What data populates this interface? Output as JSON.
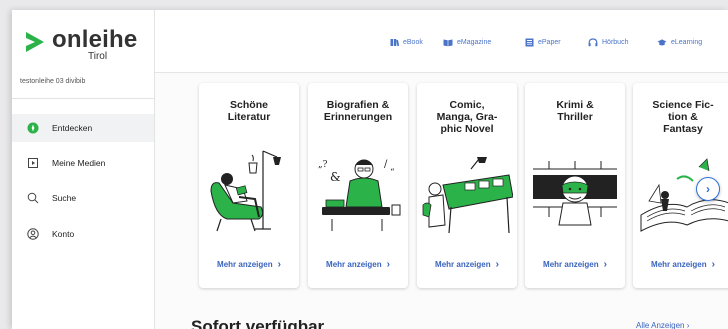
{
  "brand": {
    "name": "onleihe",
    "region": "Tirol"
  },
  "library_name": "testonleihe 03 divibib",
  "nav": [
    {
      "label": "Entdecken",
      "icon": "compass-icon",
      "active": true
    },
    {
      "label": "Meine Medien",
      "icon": "media-icon",
      "active": false
    },
    {
      "label": "Suche",
      "icon": "search-icon",
      "active": false
    },
    {
      "label": "Konto",
      "icon": "account-icon",
      "active": false
    }
  ],
  "media_types": [
    {
      "label": "eBook",
      "icon": "book-icon"
    },
    {
      "label": "eMagazine",
      "icon": "magazine-icon"
    },
    {
      "label": "ePaper",
      "icon": "newspaper-icon"
    },
    {
      "label": "Hörbuch",
      "icon": "headphones-icon"
    },
    {
      "label": "eLearning",
      "icon": "graduation-cap-icon"
    }
  ],
  "categories": [
    {
      "title": "Schöne\nLiteratur",
      "more": "Mehr anzeigen"
    },
    {
      "title": "Biografien &\nErinnerungen",
      "more": "Mehr anzeigen"
    },
    {
      "title": "Comic,\nManga, Gra-\nphic Novel",
      "more": "Mehr anzeigen"
    },
    {
      "title": "Krimi &\nThriller",
      "more": "Mehr anzeigen"
    },
    {
      "title": "Science Fic-\ntion &\nFantasy",
      "more": "Mehr anzeigen"
    }
  ],
  "section": {
    "title": "Sofort verfügbar",
    "all_link": "Alle Anzeigen"
  },
  "colors": {
    "brand_green": "#2bb34a",
    "link_blue": "#3a64bd"
  }
}
